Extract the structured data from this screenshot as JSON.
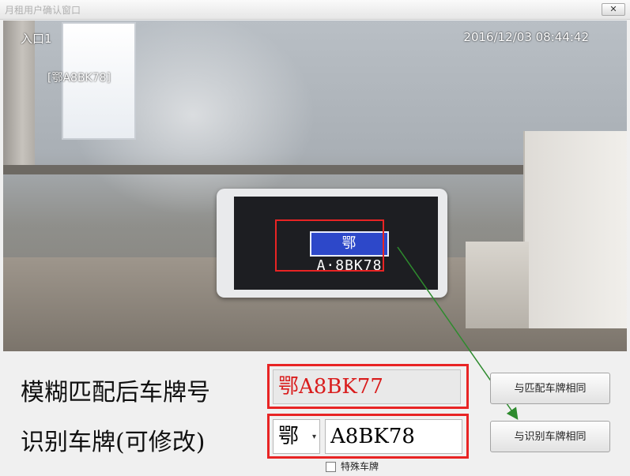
{
  "window": {
    "title": "月租用户确认窗口",
    "close_label": "✕"
  },
  "camera": {
    "channel_label": "入口1",
    "timestamp": "2016/12/03  08:44:42",
    "recognized_overlay": "[鄂A8BK78]",
    "plate_text": "鄂A·8BK78"
  },
  "form": {
    "fuzzy_label": "模糊匹配后车牌号",
    "fuzzy_value": "鄂A8BK77",
    "recognized_label": "识别车牌(可修改)",
    "province_value": "鄂",
    "plate_value": "A8BK78",
    "special_plate_label": "特殊车牌"
  },
  "buttons": {
    "same_as_matched": "与匹配车牌相同",
    "same_as_recognized": "与识别车牌相同"
  },
  "colors": {
    "highlight_red": "#e82424",
    "arrow_green": "#2e8b2e",
    "fuzzy_text": "#d91c1c"
  }
}
